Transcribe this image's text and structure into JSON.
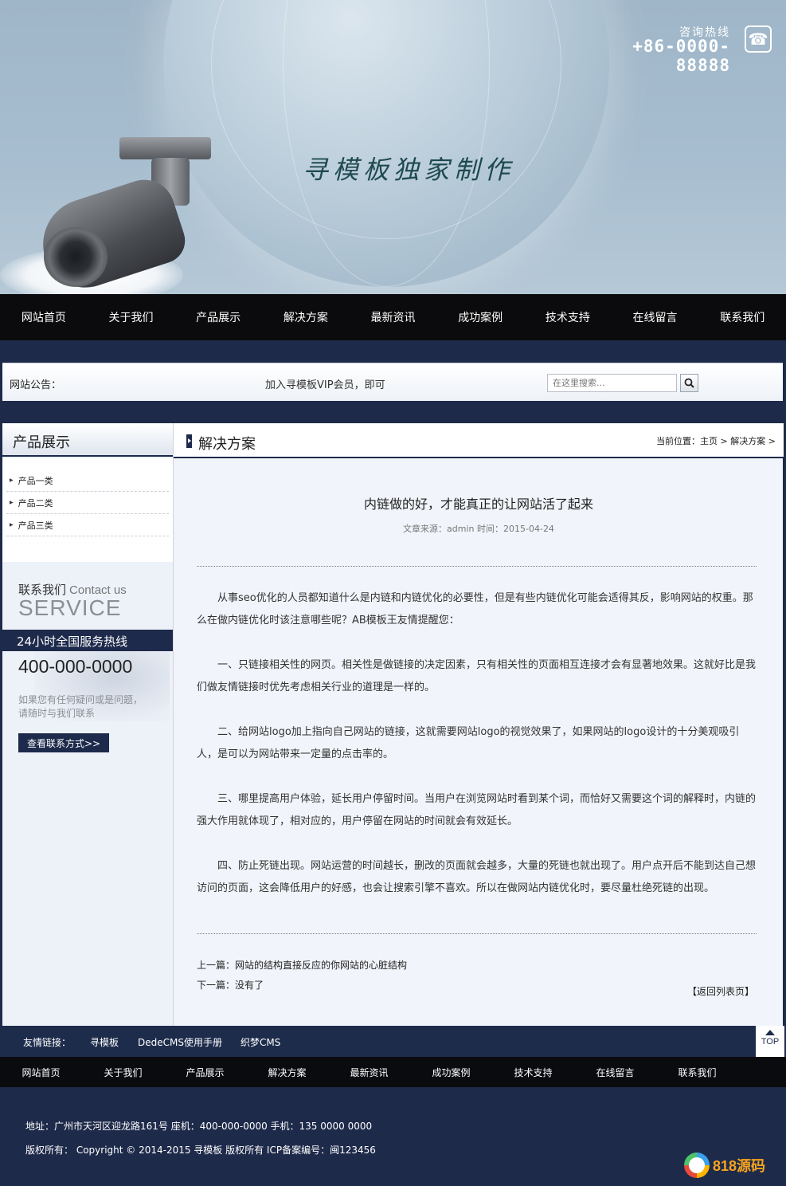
{
  "banner": {
    "slogan": "寻模板独家制作",
    "hotline_label": "咨询热线",
    "hotline_number": "+86-0000-88888"
  },
  "nav": {
    "items": [
      "网站首页",
      "关于我们",
      "产品展示",
      "解决方案",
      "最新资讯",
      "成功案例",
      "技术支持",
      "在线留言",
      "联系我们"
    ]
  },
  "notice": {
    "label": "网站公告：",
    "text": "加入寻模板VIP会员，即可",
    "search_placeholder": "在这里搜索..."
  },
  "sidebar": {
    "title": "产品展示",
    "items": [
      "产品一类",
      "产品二类",
      "产品三类"
    ],
    "contact": {
      "title_cn": "联系我们",
      "title_en": "Contact us",
      "service": "SERVICE",
      "hotline_bar": "24小时全国服务热线",
      "phone": "400-000-0000",
      "desc_line1": "如果您有任何疑问或是问题，",
      "desc_line2": "请随时与我们联系",
      "button": "查看联系方式>>"
    }
  },
  "main": {
    "title": "解决方案",
    "breadcrumb": "当前位置：主页 > 解决方案 >",
    "article": {
      "title": "内链做的好，才能真正的让网站活了起来",
      "meta": "文章来源：admin    时间：2015-04-24",
      "paragraphs": [
        "从事seo优化的人员都知道什么是内链和内链优化的必要性，但是有些内链优化可能会适得其反，影响网站的权重。那么在做内链优化时该注意哪些呢？AB模板王友情提醒您：",
        "一、只链接相关性的网页。相关性是做链接的决定因素，只有相关性的页面相互连接才会有显著地效果。这就好比是我们做友情链接时优先考虑相关行业的道理是一样的。",
        "二、给网站logo加上指向自己网站的链接，这就需要网站logo的视觉效果了，如果网站的logo设计的十分美观吸引人，是可以为网站带来一定量的点击率的。",
        "三、哪里提高用户体验，延长用户停留时间。当用户在浏览网站时看到某个词，而恰好又需要这个词的解释时，内链的强大作用就体现了，相对应的，用户停留在网站的时间就会有效延长。",
        "四、防止死链出现。网站运营的时间越长，删改的页面就会越多，大量的死链也就出现了。用户点开后不能到达自己想访问的页面，这会降低用户的好感，也会让搜索引擎不喜欢。所以在做网站内链优化时，要尽量杜绝死链的出现。"
      ],
      "prev": "上一篇：网站的结构直接反应的你网站的心脏结构",
      "next": "下一篇：没有了",
      "back": "【返回列表页】"
    }
  },
  "links": {
    "label": "友情链接：",
    "items": [
      "寻模板",
      "DedeCMS使用手册",
      "织梦CMS"
    ],
    "top": "TOP"
  },
  "footer": {
    "nav": [
      "网站首页",
      "关于我们",
      "产品展示",
      "解决方案",
      "最新资讯",
      "成功案例",
      "技术支持",
      "在线留言",
      "联系我们"
    ],
    "line1": "地址：广州市天河区迎龙路161号    座机：400-000-0000    手机：135 0000 0000",
    "line2": "版权所有： Copyright © 2014-2015 寻模板 版权所有      ICP备案编号：闽123456",
    "watermark": "818源码"
  },
  "colors": {
    "navy": "#1d2a4b",
    "nav_black": "#0b0b0d",
    "content_bg": "#f1f4fa"
  }
}
